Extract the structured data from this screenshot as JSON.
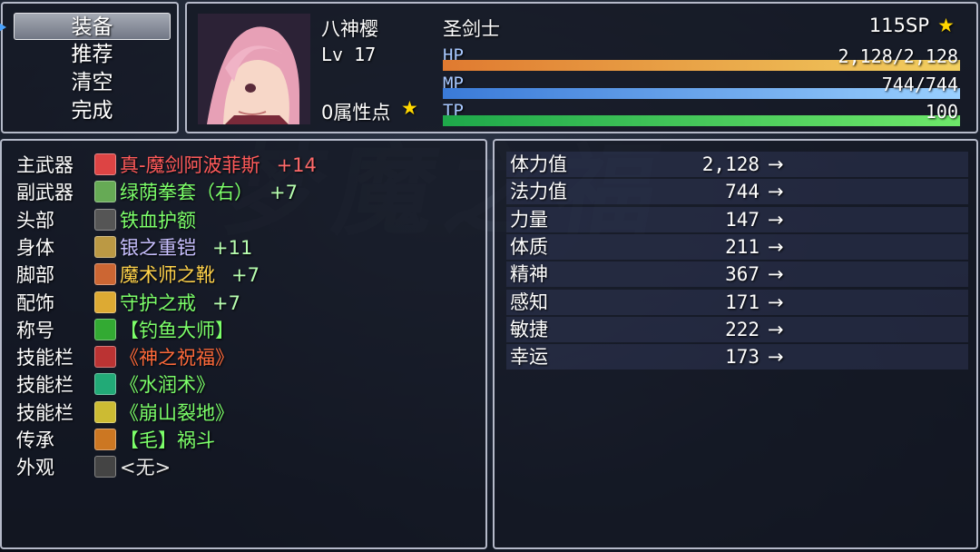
{
  "menu": {
    "items": [
      "装备",
      "推荐",
      "清空",
      "完成"
    ],
    "selected_index": 0
  },
  "actor": {
    "name": "八神樱",
    "level": "Lv 17",
    "attribute_points": "0属性点",
    "class": "圣剑士",
    "sp": "115SP",
    "hp_label": "HP",
    "hp_value": "2,128/2,128",
    "hp_fraction": 1.0,
    "mp_label": "MP",
    "mp_value": "744/744",
    "mp_fraction": 1.0,
    "tp_label": "TP",
    "tp_value": "100",
    "tp_fraction": 1.0
  },
  "equipment": [
    {
      "slot": "主武器",
      "item": "真-魔剑阿波菲斯",
      "plus": "+14",
      "color": "#ff5a5a",
      "icon": "sword-icon",
      "icon_color": "#d44"
    },
    {
      "slot": "副武器",
      "item": "绿荫拳套（右）",
      "plus": "+7",
      "color": "#7cff6a",
      "icon": "gauntlet-icon",
      "icon_color": "#6a5"
    },
    {
      "slot": "头部",
      "item": "铁血护额",
      "plus": "",
      "color": "#7cff6a",
      "icon": "headband-icon",
      "icon_color": "#555"
    },
    {
      "slot": "身体",
      "item": "银之重铠",
      "plus": "+11",
      "color": "#c9c0ff",
      "icon": "armor-icon",
      "icon_color": "#b94"
    },
    {
      "slot": "脚部",
      "item": "魔术师之靴",
      "plus": "+7",
      "color": "#ffd24a",
      "icon": "boots-icon",
      "icon_color": "#c63"
    },
    {
      "slot": "配饰",
      "item": "守护之戒",
      "plus": "+7",
      "color": "#7cff6a",
      "icon": "ring-icon",
      "icon_color": "#da3"
    },
    {
      "slot": "称号",
      "item": "【钓鱼大师】",
      "plus": "",
      "color": "#7cff6a",
      "icon": "title-icon",
      "icon_color": "#3a3"
    },
    {
      "slot": "技能栏",
      "item": "《神之祝福》",
      "plus": "",
      "color": "#ff6a3a",
      "icon": "blessing-icon",
      "icon_color": "#b33"
    },
    {
      "slot": "技能栏",
      "item": "《水润术》",
      "plus": "",
      "color": "#7cff6a",
      "icon": "water-skill-icon",
      "icon_color": "#2a7"
    },
    {
      "slot": "技能栏",
      "item": "《崩山裂地》",
      "plus": "",
      "color": "#7cff6a",
      "icon": "earth-skill-icon",
      "icon_color": "#cb3"
    },
    {
      "slot": "传承",
      "item": "【毛】祸斗",
      "plus": "",
      "color": "#7cff6a",
      "icon": "heritage-icon",
      "icon_color": "#c72"
    },
    {
      "slot": "外观",
      "item": "<无>",
      "plus": "",
      "color": "#e8e8e8",
      "icon": "empty-slot-icon",
      "icon_color": "#444"
    }
  ],
  "parameters": [
    {
      "name": "体力值",
      "value": "2,128",
      "arrow": "→"
    },
    {
      "name": "法力值",
      "value": "744",
      "arrow": "→"
    },
    {
      "name": "力量",
      "value": "147",
      "arrow": "→"
    },
    {
      "name": "体质",
      "value": "211",
      "arrow": "→"
    },
    {
      "name": "精神",
      "value": "367",
      "arrow": "→"
    },
    {
      "name": "感知",
      "value": "171",
      "arrow": "→"
    },
    {
      "name": "敏捷",
      "value": "222",
      "arrow": "→"
    },
    {
      "name": "幸运",
      "value": "173",
      "arrow": "→"
    }
  ],
  "colors": {
    "hp_gradient": [
      "#e07a30",
      "#f2d060"
    ],
    "mp_gradient": [
      "#3a7ad8",
      "#9ad0ff"
    ],
    "tp_gradient": [
      "#1ea84a",
      "#6ee86a"
    ],
    "star": "#ffd700"
  }
}
